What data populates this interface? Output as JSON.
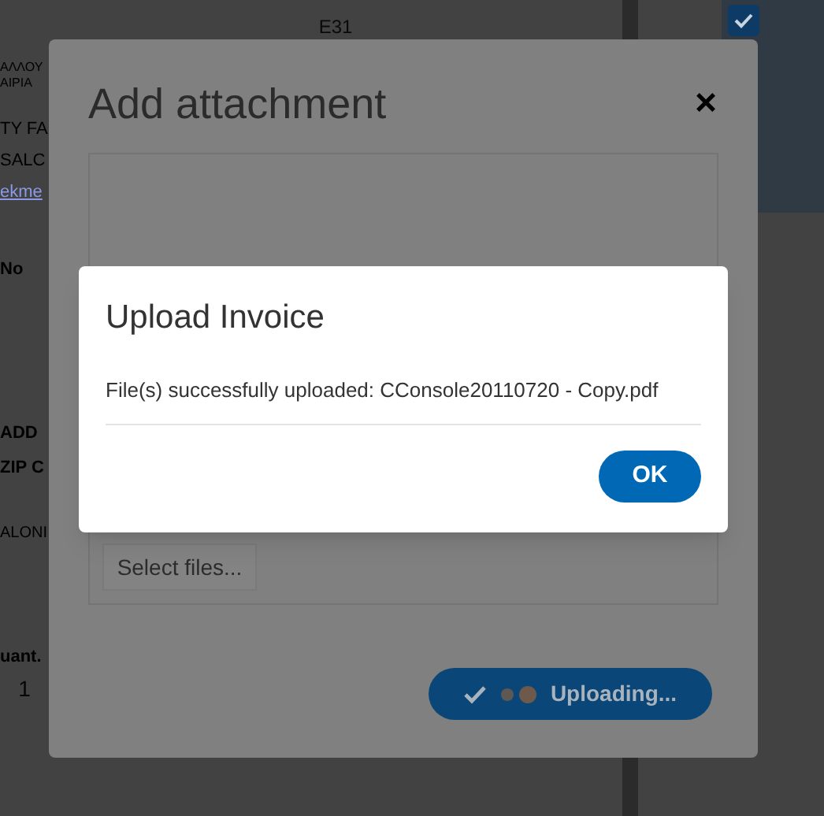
{
  "background": {
    "column_header": "E31",
    "left_texts": [
      {
        "text": "ΑΛΛΟΥ",
        "kind": "tiny"
      },
      {
        "text": "ΑΙΡΙΑ",
        "kind": "tiny"
      },
      {
        "text": "TY FA",
        "kind": "large"
      },
      {
        "text": "SALC",
        "kind": "large"
      },
      {
        "text": "ekme",
        "kind": "link"
      },
      {
        "text": "No",
        "kind": "heading"
      },
      {
        "text": "ADD",
        "kind": "heading"
      },
      {
        "text": "ZIP C",
        "kind": "heading"
      },
      {
        "text": "ALONI",
        "kind": "small"
      },
      {
        "text": "uant.",
        "kind": "heading"
      },
      {
        "text": "1",
        "kind": "value"
      }
    ],
    "checkbox": {
      "checked": true
    }
  },
  "attachment_dialog": {
    "title": "Add attachment",
    "close": "×",
    "select_button": "Select files...",
    "upload_button": "Uploading..."
  },
  "upload_dialog": {
    "title": "Upload Invoice",
    "message": "File(s) successfully uploaded: CConsole20110720 - Copy.pdf",
    "ok_button": "OK"
  }
}
